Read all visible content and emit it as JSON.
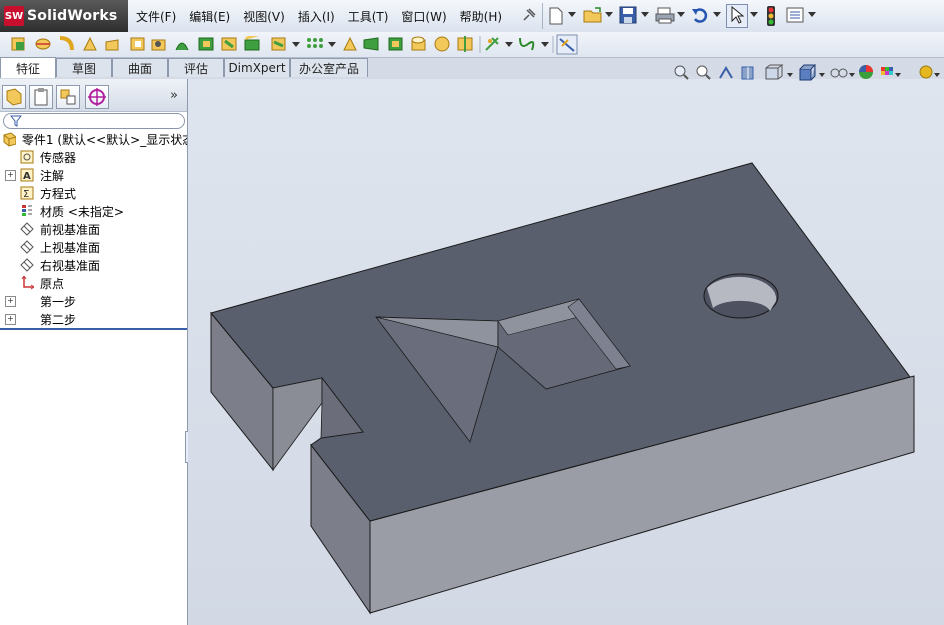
{
  "app": {
    "logo_badge": "SW",
    "logo_text": "SolidWorks"
  },
  "menus": [
    "文件(F)",
    "编辑(E)",
    "视图(V)",
    "插入(I)",
    "工具(T)",
    "窗口(W)",
    "帮助(H)"
  ],
  "tabs": [
    "特征",
    "草图",
    "曲面",
    "评估",
    "DimXpert",
    "办公室产品"
  ],
  "active_tab": "特征",
  "panel": {
    "expand_symbol": "»",
    "filter_icon": "filter-icon",
    "root": "零件1  (默认<<默认>_显示状态",
    "items": [
      {
        "label": "传感器",
        "icon": "sensor-icon",
        "expandable": false
      },
      {
        "label": "注解",
        "icon": "annotation-icon",
        "expandable": true
      },
      {
        "label": "方程式",
        "icon": "equation-icon",
        "expandable": false
      },
      {
        "label": "材质 <未指定>",
        "icon": "material-icon",
        "expandable": false
      },
      {
        "label": "前视基准面",
        "icon": "plane-icon",
        "expandable": false
      },
      {
        "label": "上视基准面",
        "icon": "plane-icon",
        "expandable": false
      },
      {
        "label": "右视基准面",
        "icon": "plane-icon",
        "expandable": false
      },
      {
        "label": "原点",
        "icon": "origin-icon",
        "expandable": false
      },
      {
        "label": "第一步",
        "icon": "feature-icon",
        "expandable": true
      },
      {
        "label": "第二步",
        "icon": "feature-icon",
        "expandable": true
      }
    ]
  },
  "colors": {
    "brand_red": "#c8102e",
    "model_top": "#5a5f6e",
    "model_front": "#9a9da6",
    "model_side": "#7c7f8a",
    "viewport_bg": "#d4dbe7"
  }
}
